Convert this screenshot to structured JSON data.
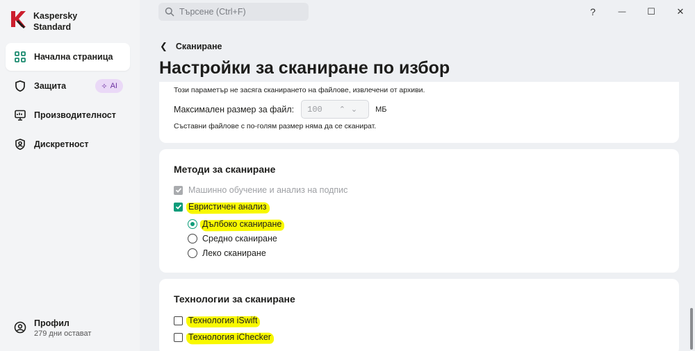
{
  "app": {
    "name_line1": "Kaspersky",
    "name_line2": "Standard",
    "brand_color": "#cc1f2e",
    "accent_color": "#0d9c7a"
  },
  "sidebar": {
    "items": [
      {
        "label": "Начална страница",
        "icon": "home-grid-icon",
        "active": true
      },
      {
        "label": "Защита",
        "icon": "shield-icon",
        "badge": "AI"
      },
      {
        "label": "Производителност",
        "icon": "monitor-icon"
      },
      {
        "label": "Дискретност",
        "icon": "privacy-shield-icon"
      }
    ],
    "profile": {
      "name": "Профил",
      "status": "279 дни остават"
    }
  },
  "header": {
    "search_placeholder": "Търсене (Ctrl+F)",
    "help": "?",
    "minimize": "—",
    "maximize": "☐",
    "close": "✕"
  },
  "page": {
    "back_label": "Сканиране",
    "title": "Настройки за сканиране по избор"
  },
  "archive_card": {
    "note_top": "Този параметър не засяга сканирането на файлове, извлечени от архиви.",
    "max_size_label": "Максимален размер за файл:",
    "max_size_value": "100",
    "unit": "МБ",
    "note_bottom": "Съставни файлове с по-голям размер няма да се сканират."
  },
  "methods_card": {
    "title": "Методи за сканиране",
    "ml_label": "Машинно обучение и анализ на подпис",
    "ml_checked": true,
    "ml_disabled": true,
    "heuristic_label": "Евристичен анализ",
    "heuristic_suffix": ":",
    "heuristic_checked": true,
    "levels": [
      {
        "label": "Дълбоко сканиране",
        "selected": true
      },
      {
        "label": "Средно сканиране",
        "selected": false
      },
      {
        "label": "Леко сканиране",
        "selected": false
      }
    ]
  },
  "tech_card": {
    "title": "Технологии за сканиране",
    "items": [
      {
        "label": "Технология iSwift",
        "checked": false
      },
      {
        "label": "Технология iChecker",
        "checked": false
      }
    ]
  }
}
